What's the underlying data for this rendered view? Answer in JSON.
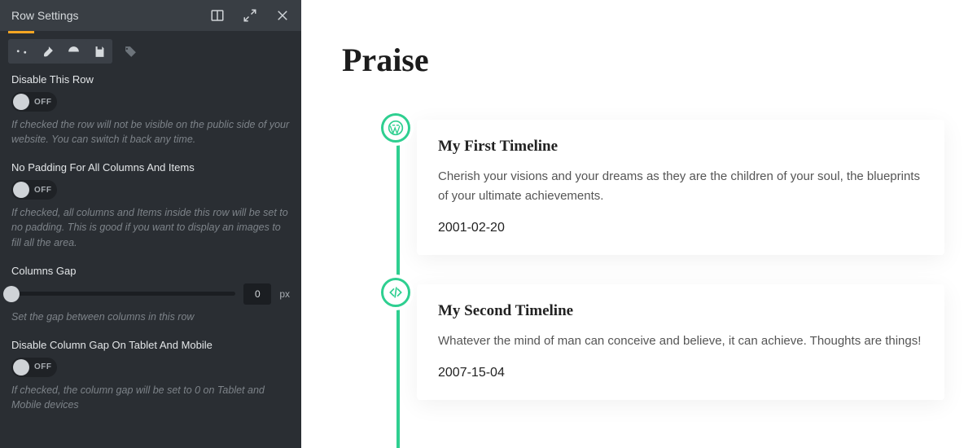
{
  "panel": {
    "title": "Row Settings",
    "tabs": [
      {
        "name": "content-tab",
        "icon": "sliders",
        "active": true,
        "grouped": true
      },
      {
        "name": "style-tab",
        "icon": "brush",
        "active": false,
        "grouped": true
      },
      {
        "name": "advanced-tab",
        "icon": "gauge",
        "active": false,
        "grouped": true
      },
      {
        "name": "save-tab",
        "icon": "save",
        "active": false,
        "grouped": true
      },
      {
        "name": "tag-tab",
        "icon": "tag",
        "active": false,
        "grouped": false,
        "dim": true
      }
    ],
    "settings": {
      "disable_row": {
        "label": "Disable This Row",
        "state": "OFF",
        "help": "If checked the row will not be visible on the public side of your website. You can switch it back any time."
      },
      "no_padding": {
        "label": "No Padding For All Columns And Items",
        "state": "OFF",
        "help": "If checked, all columns and Items inside this row will be set to no padding. This is good if you want to display an images to fill all the area."
      },
      "columns_gap": {
        "label": "Columns Gap",
        "value": "0",
        "unit": "px",
        "help": "Set the gap between columns in this row"
      },
      "disable_gap_mobile": {
        "label": "Disable Column Gap On Tablet And Mobile",
        "state": "OFF",
        "help": "If checked, the column gap will be set to 0 on Tablet and Mobile devices"
      }
    }
  },
  "preview": {
    "heading": "Praise",
    "timeline": [
      {
        "icon": "wordpress",
        "title": "My First Timeline",
        "desc": "Cherish your visions and your dreams as they are the children of your soul, the blueprints of your ultimate achievements.",
        "date": "2001-02-20"
      },
      {
        "icon": "code",
        "title": "My Second Timeline",
        "desc": "Whatever the mind of man can conceive and believe, it can achieve. Thoughts are things!",
        "date": "2007-15-04"
      }
    ]
  }
}
